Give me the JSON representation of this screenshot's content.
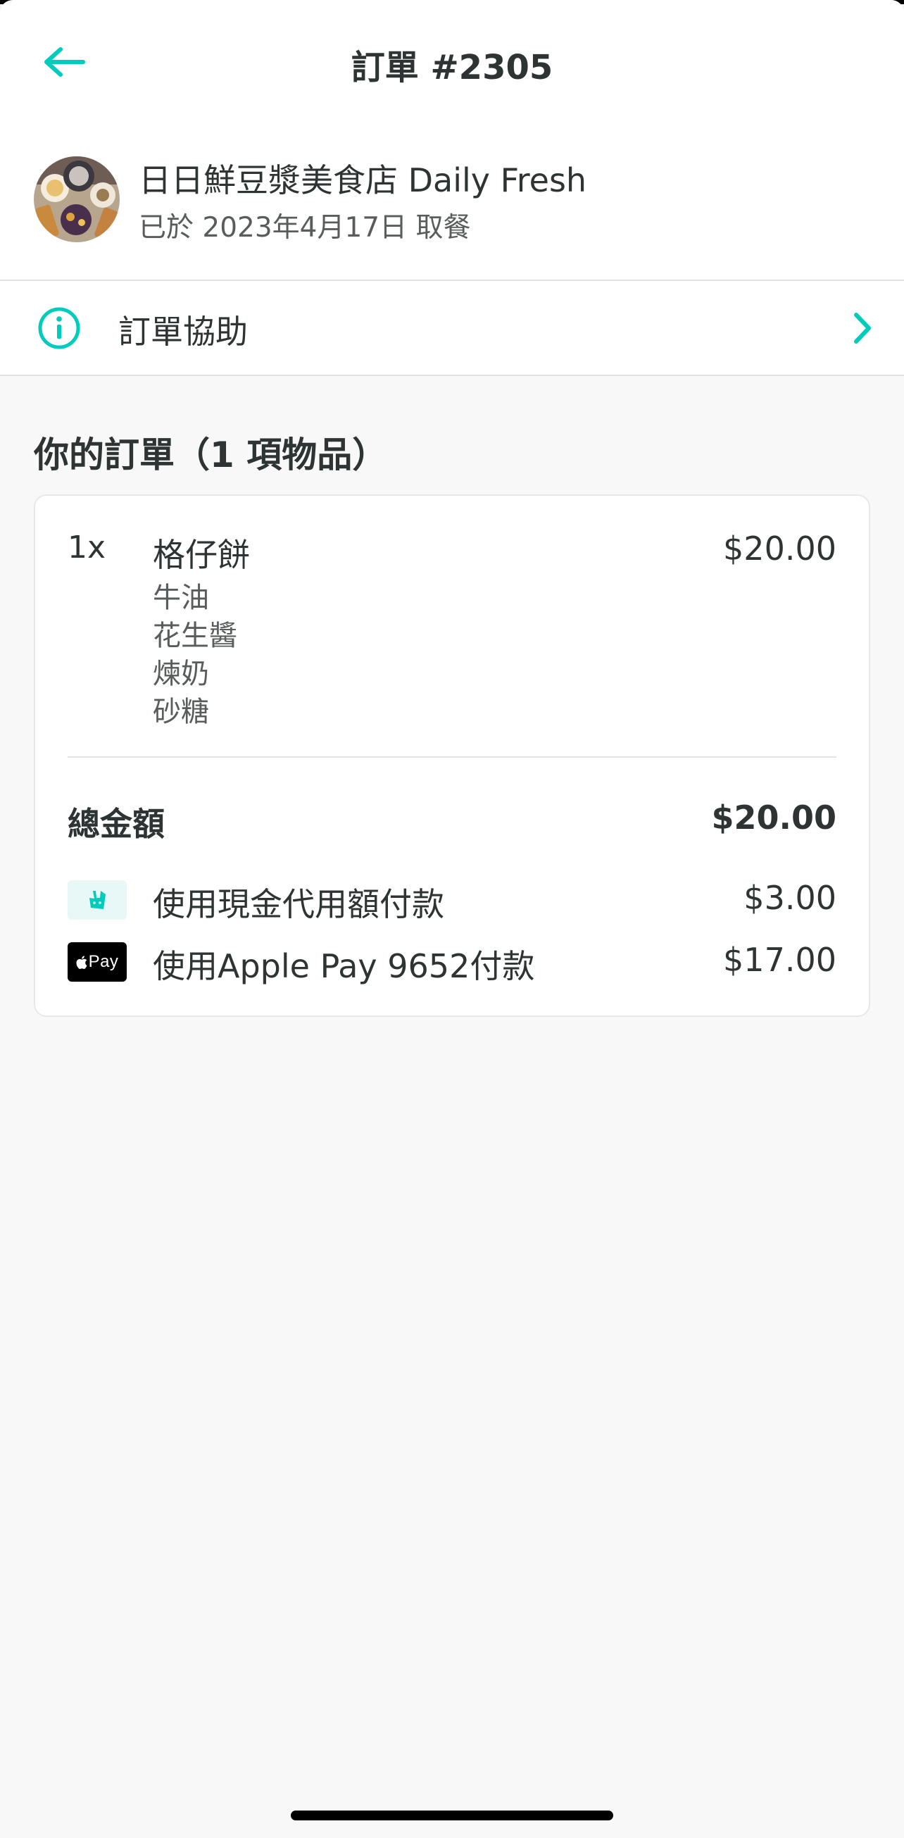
{
  "colors": {
    "accent": "#00ccbc",
    "text_primary": "#2e3333",
    "text_secondary": "#585c5c",
    "background": "#f8f8f8"
  },
  "header": {
    "title": "訂單 #2305",
    "back_icon": "arrow-left-icon"
  },
  "restaurant": {
    "name": "日日鮮豆漿美食店 Daily Fresh",
    "pickup_text": "已於 2023年4月17日 取餐"
  },
  "help": {
    "label": "訂單協助",
    "icon": "info-icon",
    "chevron_icon": "chevron-right-icon"
  },
  "order": {
    "title": "你的訂單（1 項物品）",
    "items": [
      {
        "qty": "1x",
        "name": "格仔餅",
        "price": "$20.00",
        "options": [
          "牛油",
          "花生醬",
          "煉奶",
          "砂糖"
        ]
      }
    ],
    "total_label": "總金額",
    "total_value": "$20.00",
    "payments": [
      {
        "icon": "deliveroo-credit-icon",
        "label": "使用現金代用額付款",
        "amount": "$3.00"
      },
      {
        "icon": "apple-pay-icon",
        "icon_text": "Pay",
        "label": "使用Apple Pay 9652付款",
        "amount": "$17.00"
      }
    ]
  }
}
